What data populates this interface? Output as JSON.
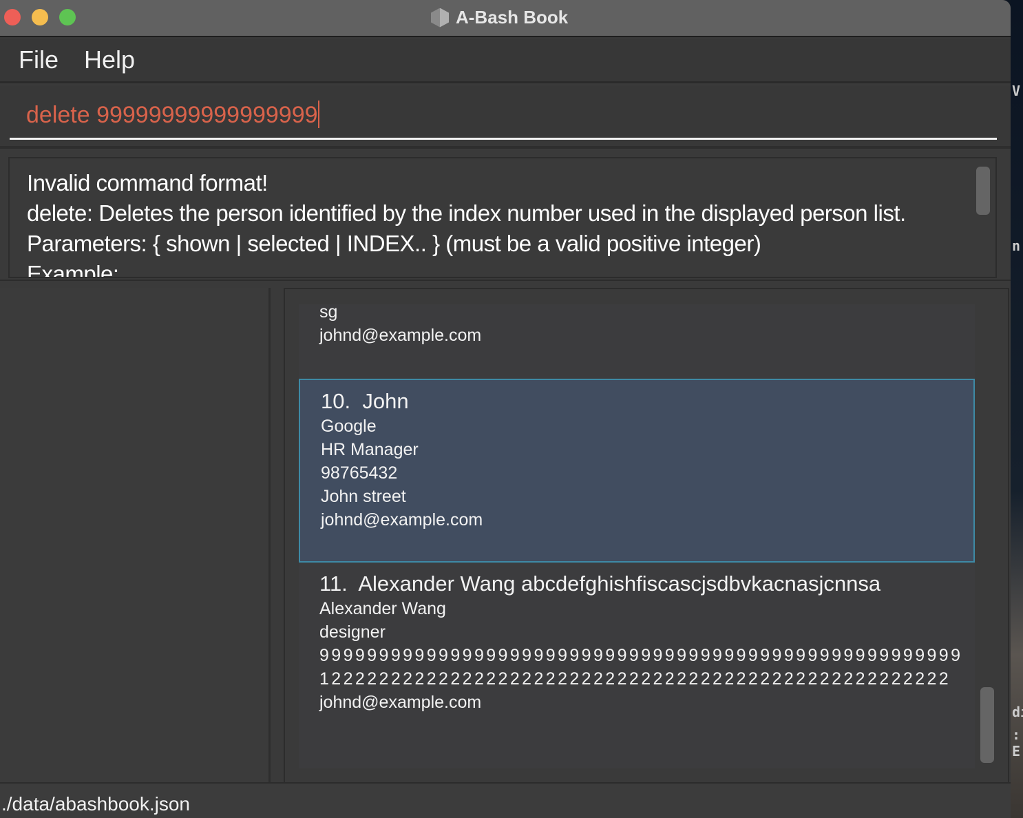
{
  "window": {
    "title": "A-Bash Book",
    "app_icon": "cube-icon"
  },
  "traffic_lights": {
    "close": "#ee5f57",
    "minimize": "#f5bd4f",
    "maximize": "#5ec453"
  },
  "menu": {
    "items": [
      "File",
      "Help"
    ]
  },
  "command_box": {
    "value": "delete 99999999999999999",
    "text_color": "#d9634b"
  },
  "result_display": {
    "lines": [
      "Invalid command format!",
      "delete: Deletes the person identified by the index number used in the displayed person list.",
      "Parameters: { shown | selected | INDEX.. } (must be a valid positive integer)",
      "Example:"
    ]
  },
  "person_list": {
    "partial_card": {
      "lines": [
        "sg",
        "johnd@example.com"
      ]
    },
    "cards": [
      {
        "index": "10.",
        "name": "John",
        "company": "Google",
        "role": "HR Manager",
        "phone": "98765432",
        "address": "John street",
        "email": "johnd@example.com",
        "selected": true
      },
      {
        "index": "11.",
        "name": "Alexander Wang abcdefghishfiscascjsdbvkacnasjcnnsa",
        "company": "Alexander Wang",
        "role": "designer",
        "phone": "999999999999999999999999999999999999999999999999999999",
        "address": "12222222222222222222222222222222222222222222222222222",
        "email": "johnd@example.com",
        "selected": false
      }
    ],
    "selected_color": "#414d60",
    "selected_border": "#3e8aa6"
  },
  "status_bar": {
    "path": "./data/abashbook.json"
  },
  "desktop": {
    "fragments": [
      "V",
      "n",
      "di",
      ": E"
    ]
  }
}
